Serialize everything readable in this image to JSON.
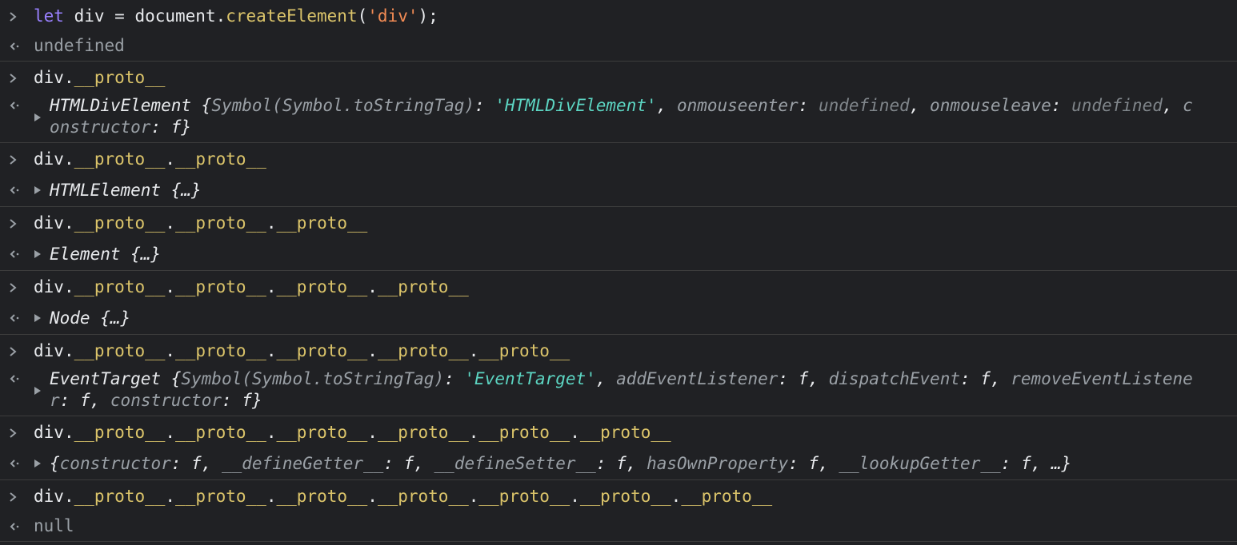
{
  "entries": [
    {
      "input": {
        "kw": "let",
        "rest1": " div = document.",
        "fn": "createElement",
        "paren_open": "(",
        "str": "'div'",
        "paren_close": ");"
      },
      "output": {
        "text": "undefined"
      }
    },
    {
      "input": {
        "base": "div",
        "chain": [
          "__proto__"
        ]
      },
      "output": {
        "name": "HTMLDivElement",
        "open": " {",
        "p1_key": "Symbol(Symbol.toStringTag)",
        "p1_sep": ": ",
        "p1_val": "'HTMLDivElement'",
        "c1": ", ",
        "p2_key": "onmouseenter",
        "p2_sep": ": ",
        "p2_val": "undefined",
        "c2": ", ",
        "p3_key": "onmouseleave",
        "p3_sep": ": ",
        "p3_val": "undefined",
        "c3": ", ",
        "p4_key": "constructor",
        "p4_sep": ": ",
        "p4_val": "f",
        "close": "}"
      }
    },
    {
      "input": {
        "base": "div",
        "chain": [
          "__proto__",
          "__proto__"
        ]
      },
      "output": {
        "text": "HTMLElement {…}"
      }
    },
    {
      "input": {
        "base": "div",
        "chain": [
          "__proto__",
          "__proto__",
          "__proto__"
        ]
      },
      "output": {
        "text": "Element {…}"
      }
    },
    {
      "input": {
        "base": "div",
        "chain": [
          "__proto__",
          "__proto__",
          "__proto__",
          "__proto__"
        ]
      },
      "output": {
        "text": "Node {…}"
      }
    },
    {
      "input": {
        "base": "div",
        "chain": [
          "__proto__",
          "__proto__",
          "__proto__",
          "__proto__",
          "__proto__"
        ]
      },
      "output": {
        "name": "EventTarget",
        "open": " {",
        "p1_key": "Symbol(Symbol.toStringTag)",
        "p1_sep": ": ",
        "p1_val": "'EventTarget'",
        "c1": ", ",
        "p2_key": "addEventListener",
        "p2_sep": ": ",
        "p2_val": "f",
        "c2": ", ",
        "p3_key": "dispatchEvent",
        "p3_sep": ": ",
        "p3_val": "f",
        "c3": ", ",
        "p4_key": "removeEventListener",
        "p4_sep": ": ",
        "p4_val": "f",
        "c4": ", ",
        "p5_key": "constructor",
        "p5_sep": ": ",
        "p5_val": "f",
        "close": "}"
      }
    },
    {
      "input": {
        "base": "div",
        "chain": [
          "__proto__",
          "__proto__",
          "__proto__",
          "__proto__",
          "__proto__",
          "__proto__"
        ]
      },
      "output": {
        "open": "{",
        "p1_key": "constructor",
        "p1_sep": ": ",
        "p1_val": "f",
        "c1": ", ",
        "p2_key": "__defineGetter__",
        "p2_sep": ": ",
        "p2_val": "f",
        "c2": ", ",
        "p3_key": "__defineSetter__",
        "p3_sep": ": ",
        "p3_val": "f",
        "c3": ", ",
        "p4_key": "hasOwnProperty",
        "p4_sep": ": ",
        "p4_val": "f",
        "c4": ", ",
        "p5_key": "__lookupGetter__",
        "p5_sep": ": ",
        "p5_val": "f",
        "c5": ", ",
        "ellipsis": "…",
        "close": "}"
      }
    },
    {
      "input": {
        "base": "div",
        "chain": [
          "__proto__",
          "__proto__",
          "__proto__",
          "__proto__",
          "__proto__",
          "__proto__",
          "__proto__"
        ]
      },
      "output": {
        "text": "null"
      }
    }
  ],
  "prompt_icons": {
    "input": "chevron-right-icon",
    "output": "return-arrow-icon",
    "expand": "expand-triangle-icon"
  },
  "colors": {
    "background": "#202124",
    "keyword": "#9980ff",
    "string": "#f28b54",
    "property": "#dbc46a",
    "value_string": "#5cd5c2",
    "muted": "#9aa0a6"
  }
}
